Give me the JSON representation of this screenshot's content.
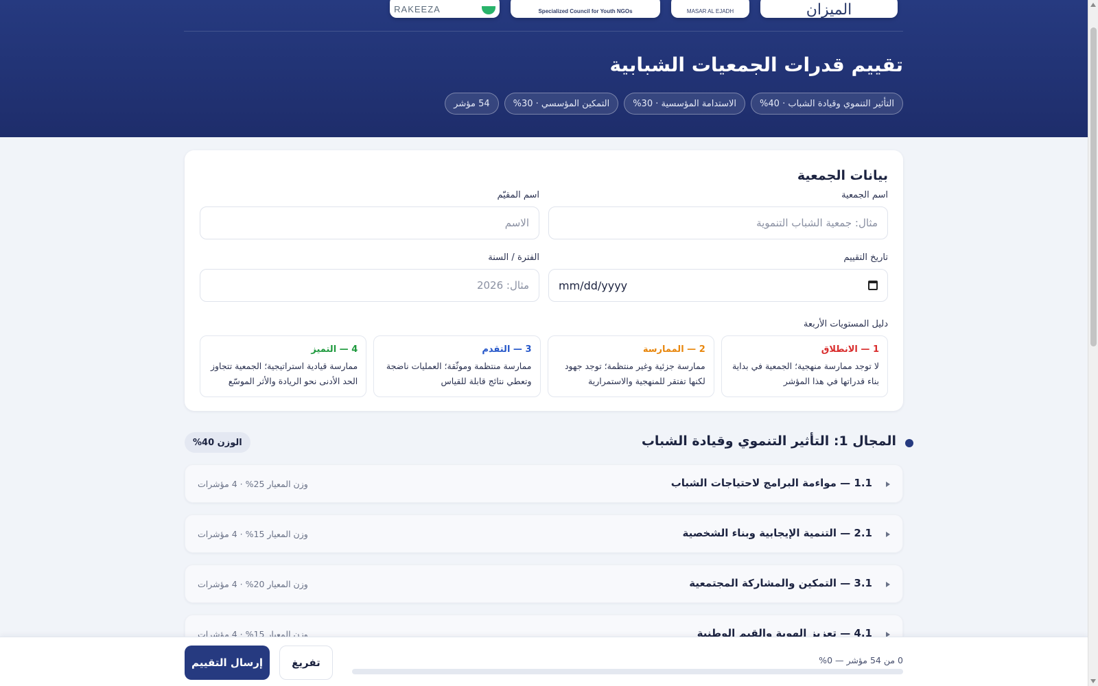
{
  "header": {
    "logos": [
      {
        "name": "rakeeza",
        "text": "RAKEEZA"
      },
      {
        "name": "youth-council",
        "text": "Specialized Council for Youth NGOs"
      },
      {
        "name": "masar-al-ejadh",
        "text": "MASAR AL EJADH"
      },
      {
        "name": "almeezan",
        "text": "الميزان"
      }
    ],
    "title": "تقييم قدرات الجمعيات الشبابية",
    "chips": [
      "التأثير التنموي وقيادة الشباب · 40%",
      "الاستدامة المؤسسية · 30%",
      "التمكين المؤسسي · 30%",
      "54 مؤشر"
    ]
  },
  "form": {
    "title": "بيانات الجمعية",
    "org_name": {
      "label": "اسم الجمعية",
      "placeholder": "مثال: جمعية الشباب التنموية",
      "value": ""
    },
    "assessor_name": {
      "label": "اسم المقيّم",
      "placeholder": "الاسم",
      "value": ""
    },
    "assessment_date": {
      "label": "تاريخ التقييم",
      "value": "mm/dd/yyyy"
    },
    "period": {
      "label": "الفترة / السنة",
      "placeholder": "مثال: 2026",
      "value": ""
    },
    "levels_label": "دليل المستويات الأربعة",
    "levels": [
      {
        "title": "1 — الانطلاق",
        "desc": "لا توجد ممارسة منهجية؛ الجمعية في بداية بناء قدراتها في هذا المؤشر",
        "color": "#d92d2d"
      },
      {
        "title": "2 — الممارسة",
        "desc": "ممارسة جزئية وغير منتظمة؛ توجد جهود لكنها تفتقر للمنهجية والاستمرارية",
        "color": "#e8870e"
      },
      {
        "title": "3 — التقدم",
        "desc": "ممارسة منتظمة وموثّقة؛ العمليات ناضجة وتعطي نتائج قابلة للقياس",
        "color": "#2456c9"
      },
      {
        "title": "4 — التميز",
        "desc": "ممارسة قيادية استراتيجية؛ الجمعية تتجاوز الحد الأدنى نحو الريادة والأثر الموسّع",
        "color": "#1f9a3e"
      }
    ]
  },
  "domain": {
    "title": "المجال 1: التأثير التنموي وقيادة الشباب",
    "weight": "الوزن 40%",
    "criteria": [
      {
        "title": "1.1 — مواءمة البرامج لاحتياجات الشباب",
        "meta": "وزن المعيار 25% · 4 مؤشرات"
      },
      {
        "title": "2.1 — التنمية الإيجابية وبناء الشخصية",
        "meta": "وزن المعيار 15% · 4 مؤشرات"
      },
      {
        "title": "3.1 — التمكين والمشاركة المجتمعية",
        "meta": "وزن المعيار 20% · 4 مؤشرات"
      },
      {
        "title": "4.1 — تعزيز الهوية والقيم الوطنية",
        "meta": "وزن المعيار 15% · 4 مؤشرات"
      }
    ]
  },
  "footer": {
    "submit_label": "إرسال التقييم",
    "clear_label": "تفريغ",
    "progress_text": "0 من 54 مؤشر — 0%",
    "progress_fraction": 0
  },
  "colors": {
    "primary": "#263a80",
    "accent_green": "#29b36a"
  }
}
